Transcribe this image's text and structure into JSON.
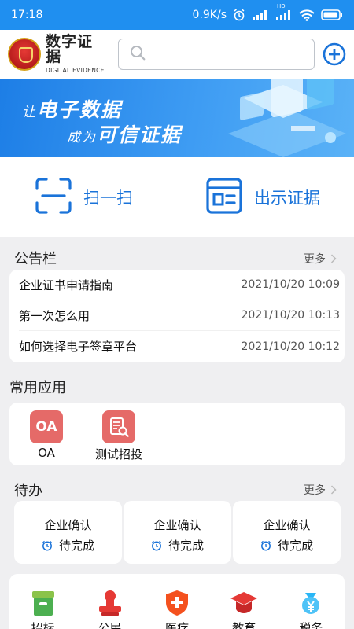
{
  "status_bar": {
    "time": "17:18",
    "speed": "0.9K/s",
    "hd": "HD"
  },
  "header": {
    "logo_cn": "数字证据",
    "logo_en": "DIGITAL EVIDENCE",
    "search_placeholder": ""
  },
  "banner": {
    "line1_small": "让",
    "line1": "电子数据",
    "line2_small": "成为",
    "line2": "可信证据"
  },
  "quick_actions": [
    {
      "label": "扫一扫",
      "icon": "scan-icon"
    },
    {
      "label": "出示证据",
      "icon": "evidence-card-icon"
    }
  ],
  "notice_board": {
    "title": "公告栏",
    "more": "更多",
    "items": [
      {
        "title": "企业证书申请指南",
        "date": "2021/10/20 10:09"
      },
      {
        "title": "第一次怎么用",
        "date": "2021/10/20 10:13"
      },
      {
        "title": "如何选择电子签章平台",
        "date": "2021/10/20 10:12"
      }
    ]
  },
  "apps": {
    "title": "常用应用",
    "items": [
      {
        "label": "OA",
        "icon_text": "OA",
        "icon": "oa-icon"
      },
      {
        "label": "测试招投",
        "icon_text": "",
        "icon": "document-search-icon"
      }
    ]
  },
  "todos": {
    "title": "待办",
    "more": "更多",
    "items": [
      {
        "title": "企业确认",
        "status": "待完成"
      },
      {
        "title": "企业确认",
        "status": "待完成"
      },
      {
        "title": "企业确认",
        "status": "待完成"
      }
    ]
  },
  "categories": [
    {
      "label": "招标",
      "icon": "archive-box-icon",
      "color": "#4caf50"
    },
    {
      "label": "公民",
      "icon": "seal-stamp-icon",
      "color": "#e53935"
    },
    {
      "label": "医疗",
      "icon": "medical-shield-icon",
      "color": "#f4511e"
    },
    {
      "label": "教育",
      "icon": "graduation-cap-icon",
      "color": "#e53935"
    },
    {
      "label": "税务",
      "icon": "tax-money-icon",
      "color": "#29b6f6"
    }
  ],
  "colors": {
    "status_bar": "#1f8ff0",
    "accent": "#1a73d9",
    "app_icon": "#e56a68"
  }
}
